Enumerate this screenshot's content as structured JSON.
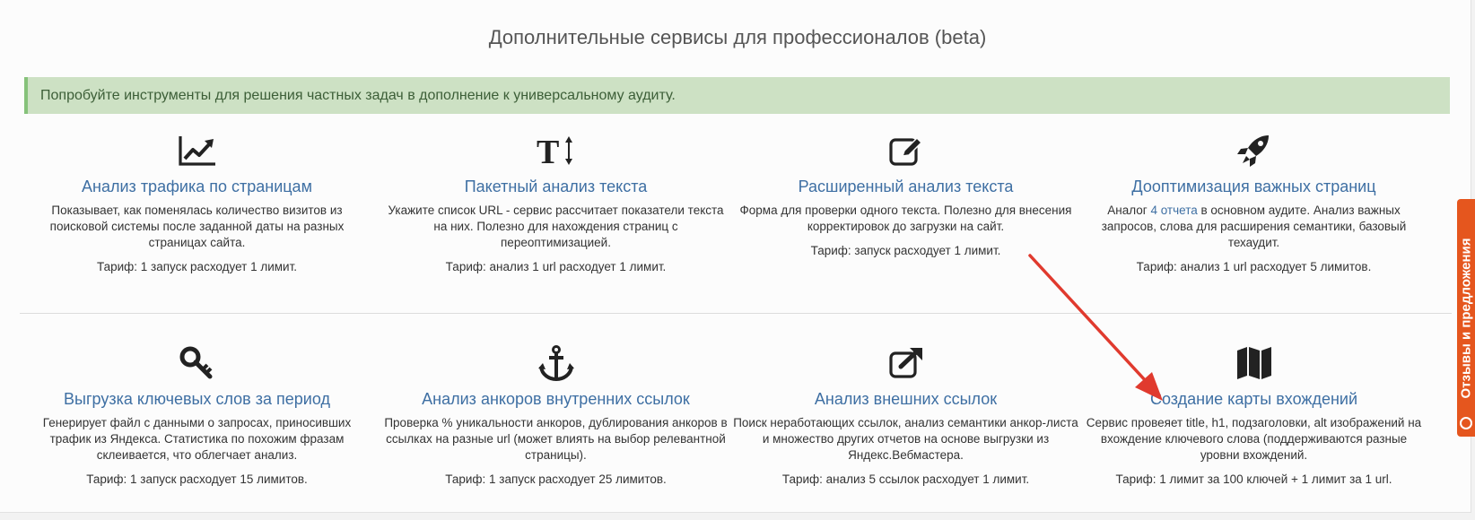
{
  "page": {
    "title": "Дополнительные сервисы для профессионалов (beta)",
    "alert": "Попробуйте инструменты для решения частных задач в дополнение к универсальному аудиту."
  },
  "services_row1": [
    {
      "icon": "line-chart-icon",
      "title": "Анализ трафика по страницам",
      "desc": "Показывает, как поменялась количество визитов из поисковой системы после заданной даты на разных страницах сайта.",
      "tariff": "Тариф: 1 запуск расходует 1 лимит."
    },
    {
      "icon": "text-height-icon",
      "title": "Пакетный анализ текста",
      "desc": "Укажите список URL - сервис рассчитает показатели текста на них. Полезно для нахождения страниц с переоптимизацией.",
      "tariff": "Тариф: анализ 1 url расходует 1 лимит."
    },
    {
      "icon": "edit-icon",
      "title": "Расширенный анализ текста",
      "desc": "Форма для проверки одного текста. Полезно для внесения корректировок до загрузки на сайт.",
      "tariff": "Тариф: запуск расходует 1 лимит."
    },
    {
      "icon": "rocket-icon",
      "title": "Дооптимизация важных страниц",
      "desc_before": "Аналог ",
      "desc_link": "4 отчета",
      "desc_after": " в основном аудите. Анализ важных запросов, слова для расширения семантики, базовый техаудит.",
      "tariff": "Тариф: анализ 1 url расходует 5 лимитов."
    }
  ],
  "services_row2": [
    {
      "icon": "key-icon",
      "title": "Выгрузка ключевых слов за период",
      "desc": "Генерирует файл с данными о запросах, приносивших трафик из Яндекса. Статистика по похожим фразам склеивается, что облегчает анализ.",
      "tariff": "Тариф: 1 запуск расходует 15 лимитов."
    },
    {
      "icon": "anchor-icon",
      "title": "Анализ анкоров внутренних ссылок",
      "desc": "Проверка % уникальности анкоров, дублирования анкоров в ссылках на разные url (может влиять на выбор релевантной страницы).",
      "tariff": "Тариф: 1 запуск расходует 25 лимитов."
    },
    {
      "icon": "external-link-icon",
      "title": "Анализ внешних ссылок",
      "desc": "Поиск неработающих ссылок, анализ семантики анкор-листа и множество других отчетов на основе выгрузки из Яндекс.Вебмастера.",
      "tariff": "Тариф: анализ 5 ссылок расходует 1 лимит."
    },
    {
      "icon": "map-icon",
      "title": "Создание карты вхождений",
      "desc": "Сервис провеяет title, h1, подзаголовки, alt изображений на вхождение ключевого слова (поддерживаются разные уровни вхождений.",
      "tariff": "Тариф: 1 лимит за 100 ключей + 1 лимит за 1 url."
    }
  ],
  "feedback_tab": {
    "label": "Отзывы и предложения"
  },
  "colors": {
    "link": "#3e6fa3",
    "alert_bg": "#cde1c4",
    "alert_border": "#86c27a",
    "feedback": "#e5561e",
    "arrow": "#e03a2e"
  }
}
